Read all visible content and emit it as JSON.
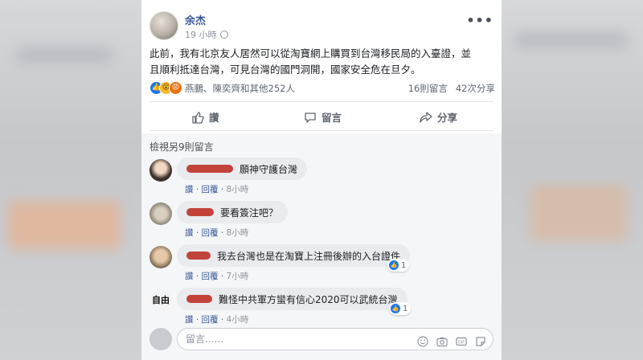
{
  "post": {
    "author": "余杰",
    "time": "19 小時",
    "text_line1": "此前，我有北京友人居然可以從淘寶網上購買到台灣移民局的入臺證，並",
    "text_line2": "且順利抵達台灣，可見台灣的國門洞開，國家安全危在旦夕。",
    "reactions_names": "燕鵬、陳奕齊和其他252人",
    "comments_count": "16則留言",
    "shares_count": "42次分享"
  },
  "actions": {
    "like": "讚",
    "comment": "留言",
    "share": "分享"
  },
  "comments": {
    "view_more": "檢視另9則留言",
    "items": [
      {
        "text": "願神守護台灣",
        "like_label": "讚",
        "reply_label": "回覆",
        "time": "8小時",
        "likes": ""
      },
      {
        "text": "要看簽注吧？",
        "like_label": "讚",
        "reply_label": "回覆",
        "time": "8小時",
        "likes": ""
      },
      {
        "text": "我去台灣也是在淘寶上注冊後辦的入台證件",
        "like_label": "讚",
        "reply_label": "回覆",
        "time": "7小時",
        "likes": "1"
      },
      {
        "text": "難怪中共軍方蠻有信心2020可以武統台灣",
        "like_label": "讚",
        "reply_label": "回覆",
        "time": "4小時",
        "likes": "1"
      }
    ],
    "input_placeholder": "留言......"
  },
  "colors": {
    "link": "#385898",
    "like_blue": "#1877f2",
    "redaction": "#c2433a"
  },
  "icons": [
    "more-icon",
    "like-icon",
    "comment-icon",
    "share-icon",
    "emoji-icon",
    "camera-icon",
    "gif-icon",
    "sticker-icon"
  ]
}
